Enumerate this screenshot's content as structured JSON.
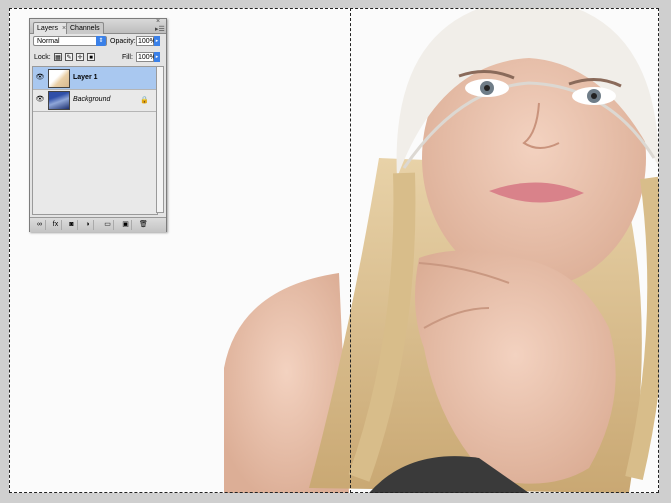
{
  "palette": {
    "tabs": [
      {
        "label": "Layers",
        "close": "×"
      },
      {
        "label": "Channels"
      }
    ],
    "blend_mode": "Normal",
    "opacity_label": "Opacity:",
    "opacity_value": "100%",
    "lock_label": "Lock:",
    "fill_label": "Fill:",
    "fill_value": "100%",
    "layers": [
      {
        "name": "Layer 1",
        "selected": true
      },
      {
        "name": "Background",
        "selected": false,
        "locked": true
      }
    ],
    "bottom_icons": [
      "link-layers-icon",
      "fx-icon",
      "layer-mask-icon",
      "adjustment-layer-icon",
      "new-group-icon",
      "new-layer-icon",
      "trash-icon"
    ],
    "bottom_glyphs": [
      "∞",
      "fx",
      "◙",
      "◑",
      "▭",
      "▣",
      "🗑"
    ]
  },
  "colors": {
    "selection": "#a9c8f0",
    "accent": "#3a80e8"
  }
}
